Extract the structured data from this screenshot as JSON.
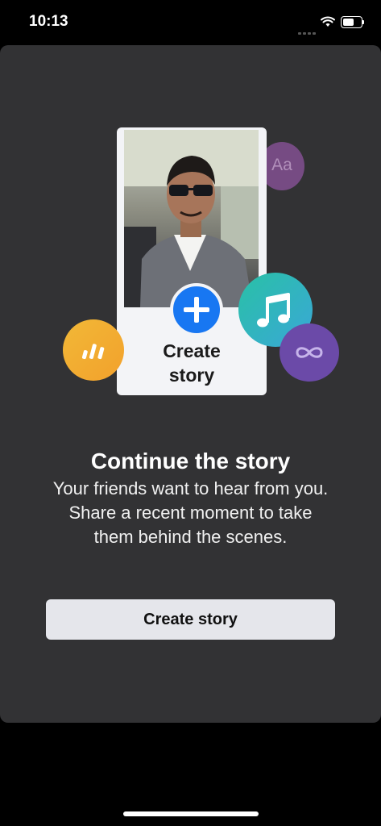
{
  "status_bar": {
    "time": "10:13"
  },
  "card": {
    "label_line1": "Create",
    "label_line2": "story"
  },
  "bubbles": {
    "text_tool": "Aa"
  },
  "prompt": {
    "headline": "Continue the story",
    "body": "Your friends want to hear from you. Share a recent moment to take them behind the scenes."
  },
  "cta": {
    "label": "Create story"
  },
  "colors": {
    "sheet_bg": "#323234",
    "accent_blue": "#1877f2",
    "button_bg": "#e5e6eb",
    "music_bubble": "#2fb8b6",
    "infinity_bubble": "#6b4aa8",
    "poll_bubble": "#f2ad33",
    "text_bubble": "#7a4d88"
  }
}
